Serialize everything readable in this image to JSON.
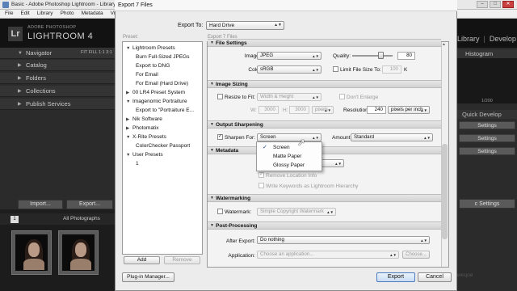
{
  "lightroom": {
    "window_title": "Basic - Adobe Photoshop Lightroom - Library",
    "window_controls": [
      "–",
      "□",
      "✕"
    ],
    "menus": [
      "File",
      "Edit",
      "Library",
      "Photo",
      "Metadata",
      "View"
    ],
    "brand_small": "ADOBE PHOTOSHOP",
    "brand": "LIGHTROOM 4",
    "logo": "Lr",
    "modules": [
      "Library",
      "|",
      "Develop"
    ],
    "left_panels": [
      "Navigator",
      "Catalog",
      "Folders",
      "Collections",
      "Publish Services"
    ],
    "navigator_zoom": "FIT  FILL  1:1  3:1",
    "import_label": "Import...",
    "export_label": "Export...",
    "screen_number": "1",
    "source_label": "All Photographs",
    "histogram_label": "Histogram",
    "histogram_value": "1/200",
    "right_items": [
      {
        "label": "Quick Develop",
        "type": "header"
      },
      {
        "label": "Settings",
        "type": "button"
      },
      {
        "label": "Settings",
        "type": "button"
      },
      {
        "label": "Settings",
        "type": "button"
      }
    ],
    "sync_label": "c Settings",
    "watermark_text": "Олег Кузнецов"
  },
  "dialog": {
    "title": "Export 7 Files",
    "export_to_label": "Export To:",
    "export_to_value": "Hard Drive",
    "preset_label": "Preset:",
    "files_label": "Export 7 Files",
    "presets": [
      {
        "type": "group",
        "expanded": true,
        "label": "Lightroom Presets"
      },
      {
        "type": "item",
        "label": "Burn Full-Sized JPEGs"
      },
      {
        "type": "item",
        "label": "Export to DNG"
      },
      {
        "type": "item",
        "label": "For Email"
      },
      {
        "type": "item",
        "label": "For Email (Hard Drive)"
      },
      {
        "type": "group",
        "expanded": false,
        "label": "00 LR4 Preset System"
      },
      {
        "type": "group",
        "expanded": true,
        "label": "Imagenomic Portraiture"
      },
      {
        "type": "item",
        "label": "Export to \"Portraiture E..."
      },
      {
        "type": "group",
        "expanded": false,
        "label": "Nik Software"
      },
      {
        "type": "group",
        "expanded": false,
        "label": "Photomatix"
      },
      {
        "type": "group",
        "expanded": true,
        "label": "X-Rite Presets"
      },
      {
        "type": "item",
        "label": "ColorChecker Passport"
      },
      {
        "type": "group",
        "expanded": true,
        "label": "User Presets"
      },
      {
        "type": "item",
        "label": "1"
      }
    ],
    "add_label": "Add",
    "remove_label": "Remove",
    "plugin_label": "Plug-in Manager...",
    "export_label": "Export",
    "cancel_label": "Cancel",
    "file_settings": {
      "header": "File Settings",
      "image_format_label": "Image Format:",
      "image_format_value": "JPEG",
      "quality_label": "Quality:",
      "quality_value": "80",
      "color_space_label": "Color Space:",
      "color_space_value": "sRGB",
      "limit_size_label": "Limit File Size To:",
      "limit_size_value": "100",
      "limit_size_unit": "K"
    },
    "image_sizing": {
      "header": "Image Sizing",
      "resize_label": "Resize to Fit:",
      "resize_value": "Width & Height",
      "dont_enlarge_label": "Don't Enlarge",
      "w_label": "W:",
      "w_value": "3000",
      "h_label": "H:",
      "h_value": "3000",
      "units_value": "pixels",
      "resolution_label": "Resolution:",
      "resolution_value": "240",
      "resolution_unit": "pixels per inch"
    },
    "output_sharpening": {
      "header": "Output Sharpening",
      "sharpen_for_label": "Sharpen For:",
      "sharpen_for_value": "Screen",
      "amount_label": "Amount:",
      "amount_value": "Standard",
      "menu_options": [
        "Screen",
        "Matte Paper",
        "Glossy Paper"
      ],
      "menu_selected": "Screen",
      "checkmark": "✓"
    },
    "metadata": {
      "header": "Metadata",
      "remove_location_label": "Remove Location Info",
      "write_keywords_label": "Write Keywords as Lightroom Hierarchy"
    },
    "watermarking": {
      "header": "Watermarking",
      "watermark_label": "Watermark:",
      "watermark_value": "Simple Copyright Watermark"
    },
    "post_processing": {
      "header": "Post-Processing",
      "after_export_label": "After Export:",
      "after_export_value": "Do nothing",
      "application_label": "Application:",
      "application_placeholder": "Choose an application...",
      "choose_label": "Choose..."
    }
  },
  "colors": {
    "lr_background": "#2b2b2b",
    "dialog_background": "#ececec",
    "default_button_border": "#4c7bbf"
  }
}
